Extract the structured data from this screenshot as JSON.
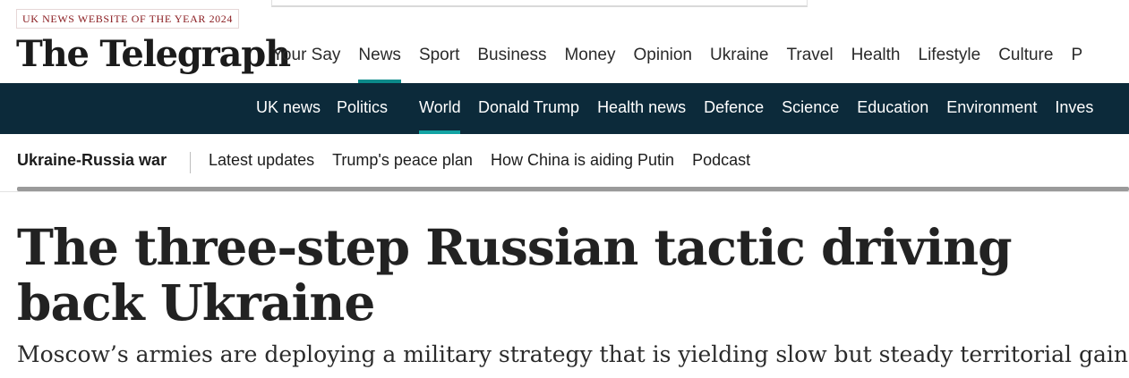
{
  "award_label": "UK NEWS WEBSITE OF THE YEAR 2024",
  "masthead": "The Telegraph",
  "primary_nav": [
    "Your Say",
    "News",
    "Sport",
    "Business",
    "Money",
    "Opinion",
    "Ukraine",
    "Travel",
    "Health",
    "Lifestyle",
    "Culture",
    "P"
  ],
  "primary_nav_active": "News",
  "section_nav": [
    "UK news",
    "Politics",
    "World",
    "Donald Trump",
    "Health news",
    "Defence",
    "Science",
    "Education",
    "Environment",
    "Inves"
  ],
  "section_nav_active": "World",
  "topic": {
    "title": "Ukraine-Russia war",
    "links": [
      "Latest updates",
      "Trump's peace plan",
      "How China is aiding Putin",
      "Podcast"
    ]
  },
  "article": {
    "headline": "The three-step Russian tactic driving back Ukraine",
    "standfirst": "Moscow’s armies are deploying a military strategy that is yielding slow but steady territorial gains"
  },
  "colors": {
    "section_bar": "#0c2a3a",
    "accent": "#0b8a8a",
    "award_text": "#8b1e22"
  }
}
